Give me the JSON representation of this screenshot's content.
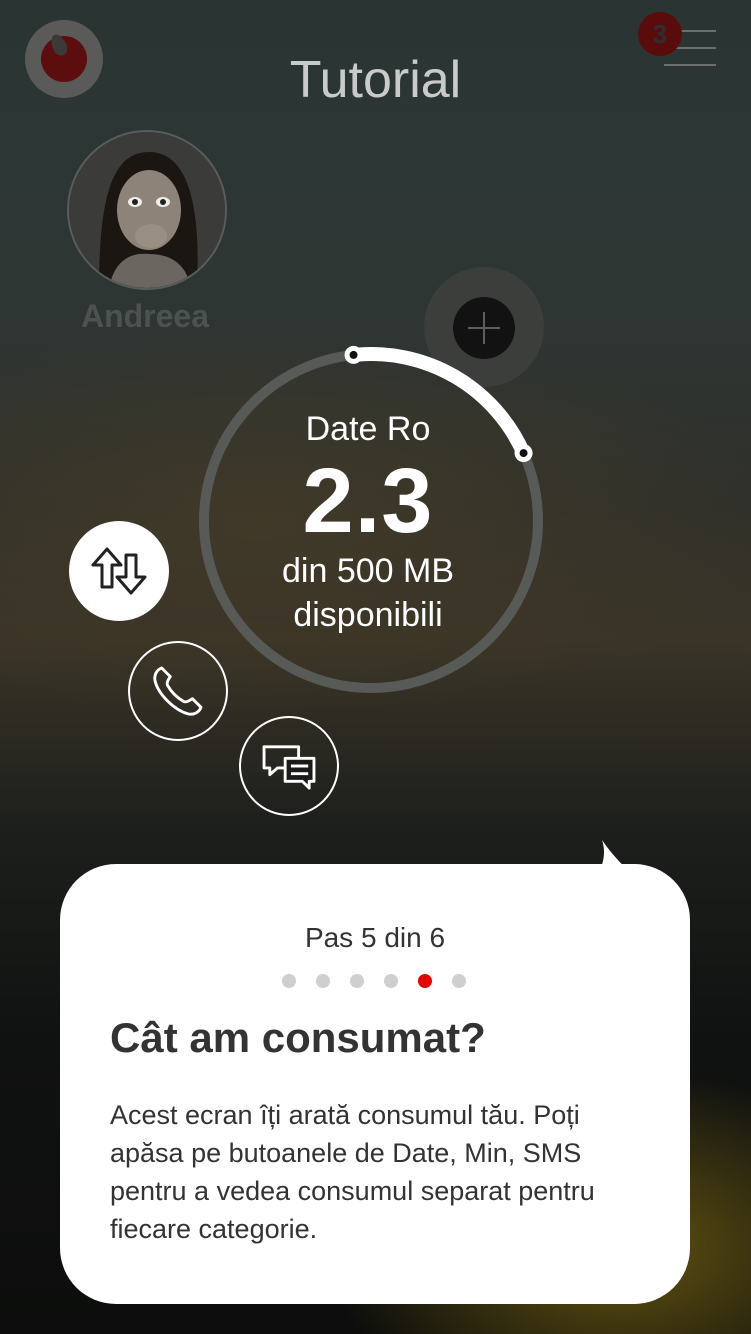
{
  "header": {
    "title": "Tutorial",
    "menu_badge": "3"
  },
  "icons": {
    "logo": "vodafone-logo",
    "menu": "hamburger-menu-icon",
    "plus": "plus-icon",
    "data": "data-transfer-arrows-icon",
    "call": "phone-icon",
    "sms": "chat-bubbles-icon"
  },
  "profile": {
    "name": "Andreea"
  },
  "usage": {
    "label": "Date Ro",
    "value": "2.3",
    "total_text": "din 500 MB",
    "available_text": "disponibili",
    "fraction_used": 0.2
  },
  "tutorial": {
    "step_text": "Pas 5 din 6",
    "current_step": 5,
    "total_steps": 6,
    "heading": "Cât am consumat?",
    "body": "Acest ecran îți arată consumul tău. Poți apăsa pe butoanele de Date, Min, SMS pentru a vedea consumul separat pentru fiecare categorie."
  },
  "colors": {
    "accent": "#e60000",
    "card": "#ffffff",
    "text": "#333333"
  }
}
